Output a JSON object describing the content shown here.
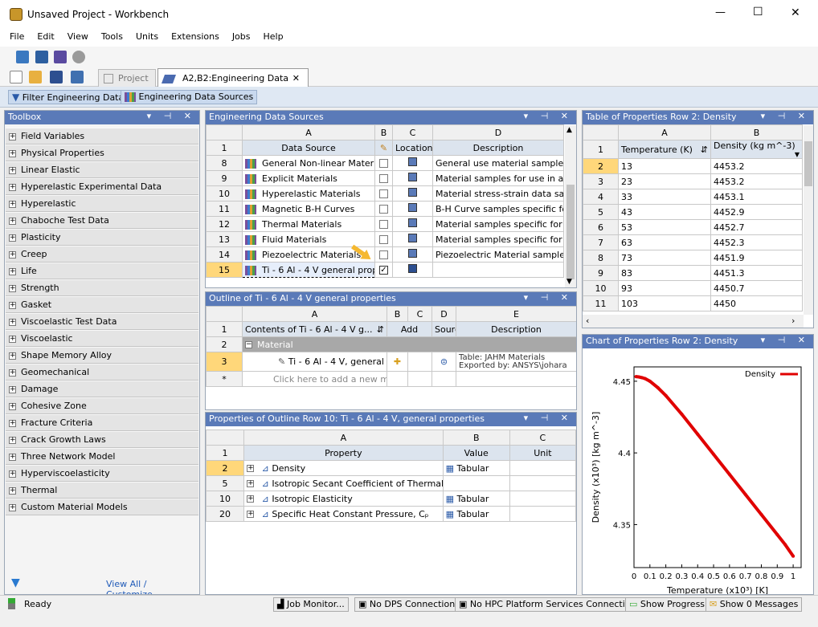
{
  "window": {
    "title": "Unsaved Project - Workbench",
    "min": "—",
    "max": "☐",
    "close": "✕"
  },
  "menu": [
    "File",
    "Edit",
    "View",
    "Tools",
    "Units",
    "Extensions",
    "Jobs",
    "Help"
  ],
  "tabs": {
    "project": "Project",
    "engdata": "A2,B2:Engineering Data",
    "close": "✕"
  },
  "filter": {
    "filter_label": "Filter Engineering Data",
    "sources_label": "Engineering Data Sources"
  },
  "toolbox": {
    "title": "Toolbox",
    "items": [
      "Field Variables",
      "Physical Properties",
      "Linear Elastic",
      "Hyperelastic Experimental Data",
      "Hyperelastic",
      "Chaboche Test Data",
      "Plasticity",
      "Creep",
      "Life",
      "Strength",
      "Gasket",
      "Viscoelastic Test Data",
      "Viscoelastic",
      "Shape Memory Alloy",
      "Geomechanical",
      "Damage",
      "Cohesive Zone",
      "Fracture Criteria",
      "Crack Growth Laws",
      "Three Network Model",
      "Hyperviscoelasticity",
      "Thermal",
      "Custom Material Models"
    ],
    "view_all": "View All / Customize..."
  },
  "sources": {
    "title": "Engineering Data Sources",
    "cols": [
      "A",
      "B",
      "C",
      "D"
    ],
    "headers": [
      "Data Source",
      "Location",
      "Description"
    ],
    "rows": [
      {
        "n": "8",
        "name": "General Non-linear Materials",
        "desc": "General use material samples for"
      },
      {
        "n": "9",
        "name": "Explicit Materials",
        "desc": "Material samples for use in an ex"
      },
      {
        "n": "10",
        "name": "Hyperelastic Materials",
        "desc": "Material stress-strain data samp"
      },
      {
        "n": "11",
        "name": "Magnetic B-H Curves",
        "desc": "B-H Curve samples specific for u"
      },
      {
        "n": "12",
        "name": "Thermal Materials",
        "desc": "Material samples specific for use"
      },
      {
        "n": "13",
        "name": "Fluid Materials",
        "desc": "Material samples specific for use"
      },
      {
        "n": "14",
        "name": "Piezoelectric Materials",
        "desc": "Piezoelectric Material samples sp"
      },
      {
        "n": "15",
        "name": "Ti - 6 Al - 4 V general prope",
        "desc": ""
      }
    ]
  },
  "outline": {
    "title": "Outline of Ti - 6 Al - 4 V general properties",
    "cols": [
      "A",
      "B",
      "C",
      "D",
      "E"
    ],
    "h_contents": "Contents of Ti - 6 Al - 4 V g...",
    "h_add": "Add",
    "h_source": "Source",
    "h_desc": "Description",
    "material_label": "Material",
    "item_name": "Ti - 6 Al - 4 V, general p",
    "item_desc1": "Table: JAHM Materials",
    "item_desc2": "Exported by: ANSYS\\johara",
    "add_new": "Click here to add a new mater",
    "rows": [
      "1",
      "2",
      "3",
      "*"
    ]
  },
  "props": {
    "title": "Properties of Outline Row 10: Ti - 6 Al - 4 V, general properties",
    "cols": [
      "A",
      "B",
      "C"
    ],
    "headers": [
      "Property",
      "Value",
      "Unit"
    ],
    "rows": [
      {
        "n": "1"
      },
      {
        "n": "2",
        "name": "Density",
        "value": "Tabular"
      },
      {
        "n": "5",
        "name": "Isotropic Secant Coefficient of Thermal E",
        "value": ""
      },
      {
        "n": "10",
        "name": "Isotropic Elasticity",
        "value": "Tabular"
      },
      {
        "n": "20",
        "name": "Specific Heat Constant Pressure, Cₚ",
        "value": "Tabular"
      }
    ]
  },
  "table": {
    "title": "Table of Properties Row 2: Density",
    "cols": [
      "A",
      "B"
    ],
    "h_temp": "Temperature (K)",
    "h_dens": "Density (kg m^-3)",
    "rows": [
      {
        "n": "2",
        "t": "13",
        "d": "4453.2"
      },
      {
        "n": "3",
        "t": "23",
        "d": "4453.2"
      },
      {
        "n": "4",
        "t": "33",
        "d": "4453.1"
      },
      {
        "n": "5",
        "t": "43",
        "d": "4452.9"
      },
      {
        "n": "6",
        "t": "53",
        "d": "4452.7"
      },
      {
        "n": "7",
        "t": "63",
        "d": "4452.3"
      },
      {
        "n": "8",
        "t": "73",
        "d": "4451.9"
      },
      {
        "n": "9",
        "t": "83",
        "d": "4451.3"
      },
      {
        "n": "10",
        "t": "93",
        "d": "4450.7"
      },
      {
        "n": "11",
        "t": "103",
        "d": "4450"
      }
    ]
  },
  "chart": {
    "title": "Chart of Properties Row 2: Density"
  },
  "chart_data": {
    "type": "line",
    "xlabel": "Temperature (x10³) [K]",
    "ylabel": "Density (x10³) [kg m^-3]",
    "legend": "top-right",
    "grid": false,
    "xlim": [
      0,
      1.05
    ],
    "ylim": [
      4.32,
      4.46
    ],
    "xticks": [
      "0",
      "0.1",
      "0.2",
      "0.3",
      "0.4",
      "0.5",
      "0.6",
      "0.7",
      "0.8",
      "0.9",
      "1"
    ],
    "yticks": [
      "4.35",
      "4.4",
      "4.45"
    ],
    "series": [
      {
        "name": "Density",
        "color": "#e00000",
        "x": [
          0.013,
          0.03,
          0.05,
          0.07,
          0.1,
          0.15,
          0.2,
          0.3,
          0.4,
          0.5,
          0.6,
          0.7,
          0.8,
          0.9,
          0.95,
          1.0
        ],
        "y": [
          4.4532,
          4.453,
          4.4525,
          4.4518,
          4.45,
          4.4455,
          4.44,
          4.427,
          4.413,
          4.399,
          4.385,
          4.371,
          4.357,
          4.343,
          4.336,
          4.328
        ]
      }
    ]
  },
  "status": {
    "ready": "Ready",
    "job": "Job Monitor...",
    "dps": "No DPS Connection",
    "hpc": "No HPC Platform Services Connection",
    "progress": "Show Progress",
    "messages": "Show 0 Messages"
  }
}
